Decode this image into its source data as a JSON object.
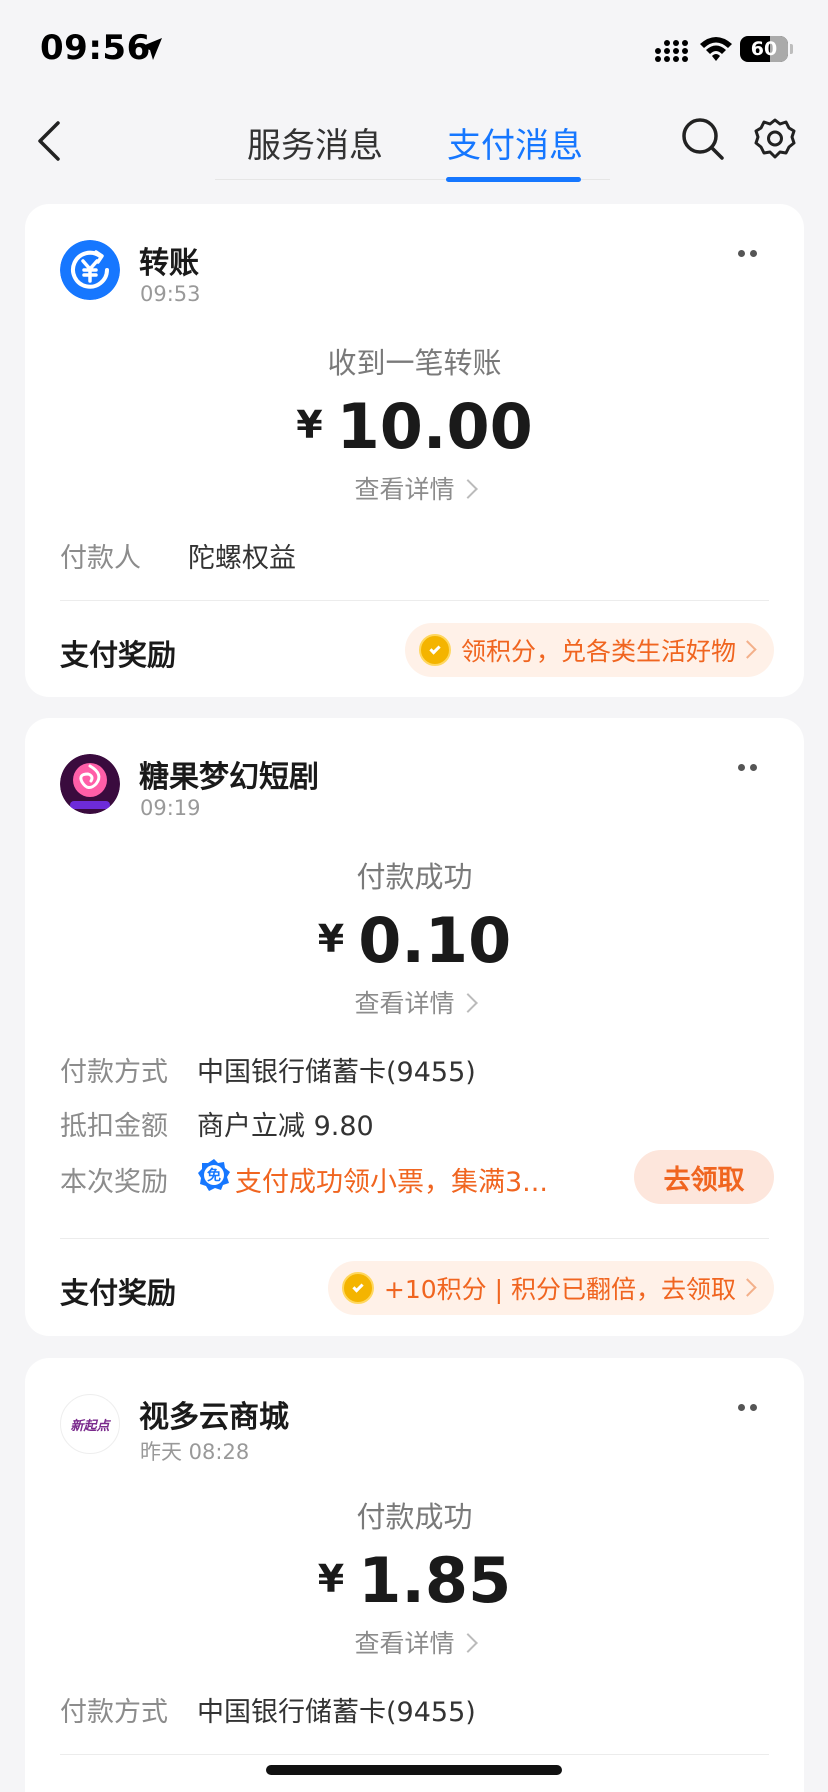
{
  "status_bar": {
    "time": "09:56",
    "battery": "60"
  },
  "nav": {
    "tab_service": "服务消息",
    "tab_pay": "支付消息"
  },
  "cards": [
    {
      "merchant": "转账",
      "time": "09:53",
      "status": "收到一笔转账",
      "currency": "¥",
      "amount": "10.00",
      "detail_link": "查看详情",
      "rows": [
        {
          "label": "付款人",
          "value": "陀螺权益"
        }
      ],
      "reward_title": "支付奖励",
      "reward_pill": "领积分，兑各类生活好物"
    },
    {
      "merchant": "糖果梦幻短剧",
      "time": "09:19",
      "status": "付款成功",
      "currency": "¥",
      "amount": "0.10",
      "detail_link": "查看详情",
      "rows": [
        {
          "label": "付款方式",
          "value": "中国银行储蓄卡(9455)"
        },
        {
          "label": "抵扣金额",
          "value": "商户立减 9.80"
        },
        {
          "label": "本次奖励",
          "value": "支付成功领小票，集满3..."
        }
      ],
      "bonus_icon_text": "免",
      "claim_button": "去领取",
      "reward_title": "支付奖励",
      "reward_pill": "+10积分 | 积分已翻倍，去领取"
    },
    {
      "merchant": "视多云商城",
      "time": "昨天 08:28",
      "status": "付款成功",
      "currency": "¥",
      "amount": "1.85",
      "detail_link": "查看详情",
      "rows": [
        {
          "label": "付款方式",
          "value": "中国银行储蓄卡(9455)"
        }
      ],
      "avatar_text": "新起点"
    }
  ],
  "colors": {
    "accent": "#1677ff",
    "reward_orange": "#f06520",
    "background": "#f5f5f7"
  }
}
